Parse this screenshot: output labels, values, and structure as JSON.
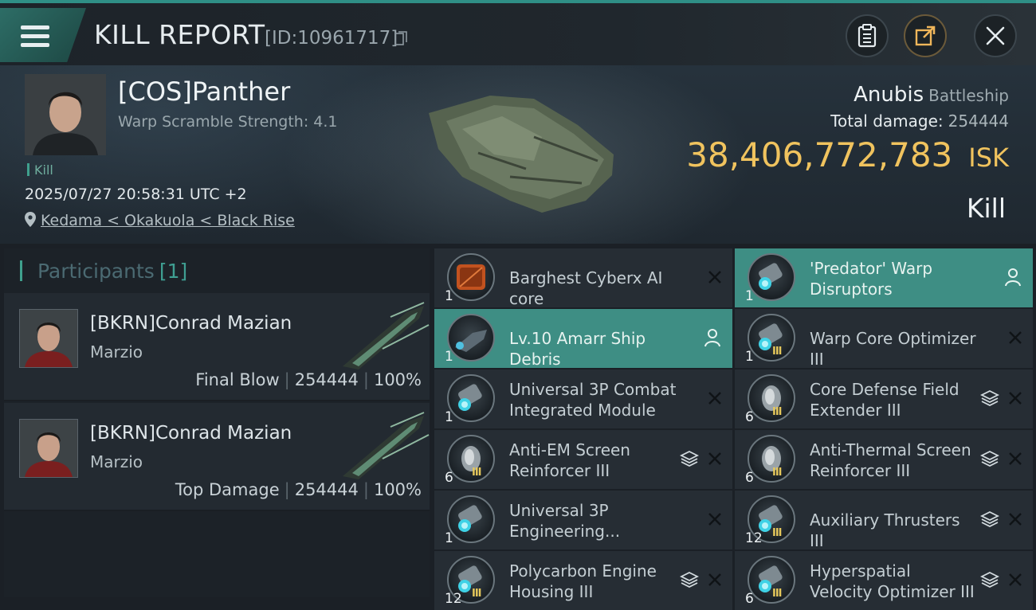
{
  "header": {
    "title": "KILL REPORT",
    "report_id": "[ID:10961717]"
  },
  "victim": {
    "name": "[COS]Panther",
    "warp_scramble": "Warp Scramble Strength: 4.1",
    "kill_tag": "Kill",
    "datetime": "2025/07/27 20:58:31 UTC +2",
    "location": "Kedama < Okakuola < Black Rise",
    "ship_name": "Anubis",
    "ship_class": "Battleship",
    "total_damage_label": "Total damage:",
    "total_damage": "254444",
    "isk_value": "38,406,772,783",
    "isk_unit": "ISK",
    "result": "Kill"
  },
  "participants": {
    "label": "Participants",
    "count": "[1]",
    "list": [
      {
        "name": "[BKRN]Conrad Mazian",
        "corp": "Marzio",
        "role": "Final Blow",
        "damage": "254444",
        "percent": "100%"
      },
      {
        "name": "[BKRN]Conrad Mazian",
        "corp": "Marzio",
        "role": "Top Damage",
        "damage": "254444",
        "percent": "100%"
      }
    ]
  },
  "items": [
    {
      "name": "Barghest Cyberx AI core",
      "qty": "1",
      "kind": "core",
      "state": "destroyed",
      "highlight": false
    },
    {
      "name": "'Predator' Warp Disruptors",
      "qty": "1",
      "kind": "module",
      "state": "dropped",
      "highlight": true
    },
    {
      "name": "Lv.10 Amarr Ship Debris",
      "qty": "1",
      "kind": "debris",
      "state": "dropped",
      "highlight": true
    },
    {
      "name": "Warp Core Optimizer III",
      "qty": "1",
      "kind": "module",
      "state": "destroyed",
      "highlight": false
    },
    {
      "name": "Universal 3P Combat Integrated Module",
      "qty": "1",
      "kind": "module",
      "state": "destroyed",
      "highlight": false
    },
    {
      "name": "Core Defense Field Extender III",
      "qty": "6",
      "kind": "shield",
      "state": "destroyed",
      "highlight": false
    },
    {
      "name": "Anti-EM Screen Reinforcer III",
      "qty": "6",
      "kind": "shield",
      "state": "destroyed",
      "highlight": false
    },
    {
      "name": "Anti-Thermal Screen Reinforcer III",
      "qty": "6",
      "kind": "shield",
      "state": "destroyed",
      "highlight": false
    },
    {
      "name": "Universal 3P Engineering...",
      "qty": "1",
      "kind": "module",
      "state": "destroyed",
      "highlight": false
    },
    {
      "name": "Auxiliary Thrusters III",
      "qty": "12",
      "kind": "module",
      "state": "destroyed",
      "highlight": false
    },
    {
      "name": "Polycarbon Engine Housing III",
      "qty": "12",
      "kind": "module",
      "state": "destroyed",
      "highlight": false
    },
    {
      "name": "Hyperspatial Velocity Optimizer III",
      "qty": "6",
      "kind": "module",
      "state": "destroyed",
      "highlight": false
    }
  ],
  "colors": {
    "accent_teal": "#3e8e84",
    "isk_gold": "#f0c35e",
    "background": "#1b2026"
  },
  "icons": [
    "menu-icon",
    "copy-icon",
    "clipboard-icon",
    "share-icon",
    "close-icon",
    "location-pin-icon",
    "stack-icon",
    "person-icon"
  ]
}
